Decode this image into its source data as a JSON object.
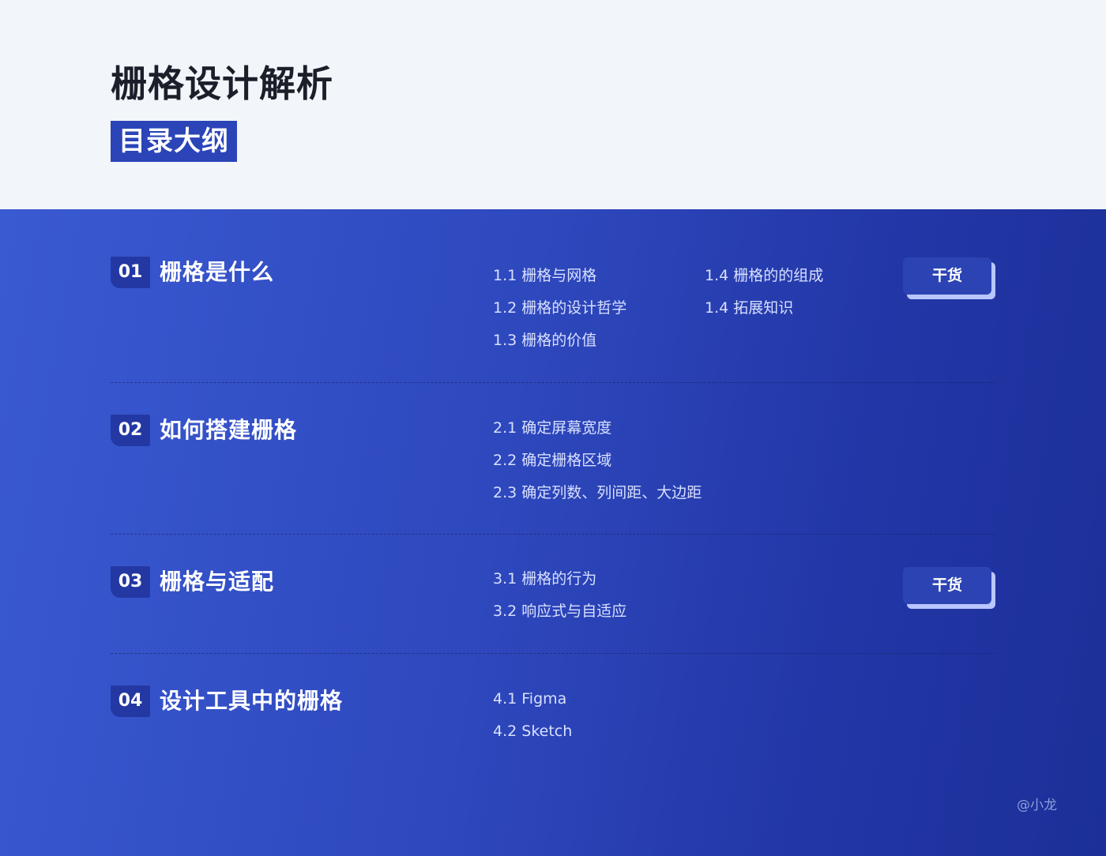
{
  "header": {
    "title": "栅格设计解析",
    "subtitle": "目录大纲"
  },
  "sections": [
    {
      "number": "01",
      "title": "栅格是什么",
      "col1": [
        "1.1 栅格与网格",
        "1.2 栅格的设计哲学",
        "1.3 栅格的价值"
      ],
      "col2": [
        "1.4 栅格的的组成",
        "1.4 拓展知识"
      ],
      "tag": "干货"
    },
    {
      "number": "02",
      "title": "如何搭建栅格",
      "col1": [
        "2.1 确定屏幕宽度",
        "2.2 确定栅格区域",
        "2.3 确定列数、列间距、大边距"
      ]
    },
    {
      "number": "03",
      "title": "栅格与适配",
      "col1": [
        "3.1 栅格的行为",
        "3.2 响应式与自适应"
      ],
      "tag": "干货"
    },
    {
      "number": "04",
      "title": "设计工具中的栅格",
      "col1": [
        "4.1 Figma",
        "4.2 Sketch"
      ]
    }
  ],
  "signature": "@小龙",
  "colors": {
    "header_bg": "#f2f5f9",
    "accent": "#2b44b8",
    "panel_gradient_start": "#3a5ad2",
    "panel_gradient_end": "#1c2f98",
    "tag_shadow": "#b9c6ff"
  }
}
